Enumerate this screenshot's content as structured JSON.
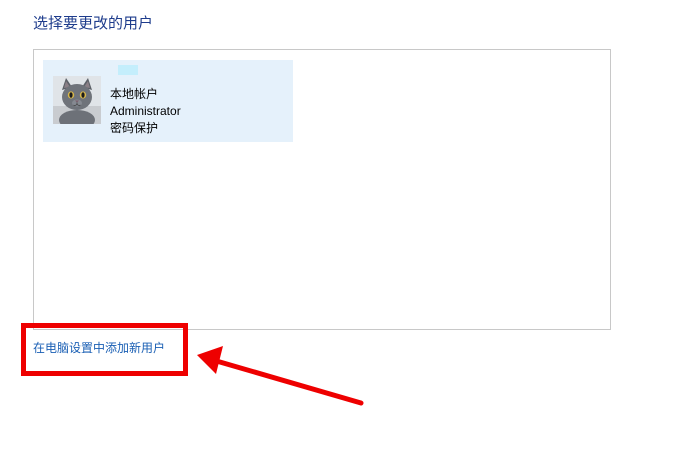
{
  "page": {
    "title": "选择要更改的用户"
  },
  "account": {
    "type": "本地帐户",
    "name": "Administrator",
    "status": "密码保护"
  },
  "add_user_link": {
    "label": "在电脑设置中添加新用户"
  },
  "annotation": {
    "color": "#ee0000"
  },
  "colors": {
    "title": "#1e3c8c",
    "link": "#1a5fb4",
    "tile_background": "#e5f1fb",
    "panel_border": "#c8c8c8"
  },
  "icons": {
    "avatar": "gray-cat-avatar"
  }
}
